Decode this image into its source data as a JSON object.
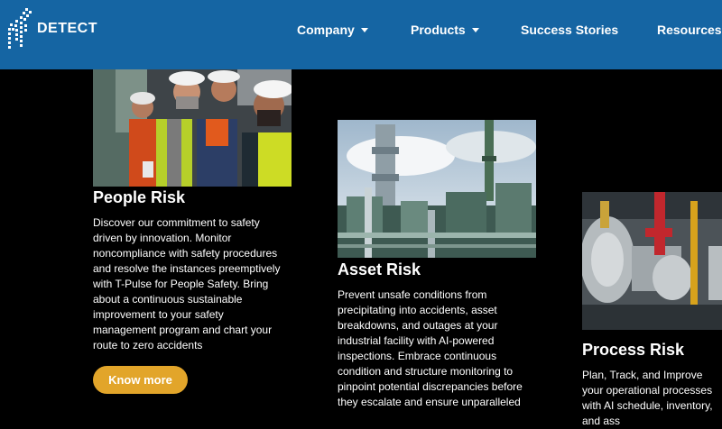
{
  "nav": {
    "logo_text": "DETECT",
    "items": [
      {
        "label": "Company"
      },
      {
        "label": "Products"
      },
      {
        "label": "Success Stories"
      },
      {
        "label": "Resources"
      }
    ]
  },
  "cards": [
    {
      "title": "People Risk",
      "description": "Discover our commitment to safety driven by innovation. Monitor noncompliance with safety procedures and resolve the instances preemptively with T-Pulse for People Safety. Bring about a continuous sustainable improvement to your safety management program and chart your route to zero accidents",
      "button_label": "Know more"
    },
    {
      "title": "Asset Risk",
      "description": "Prevent unsafe conditions from precipitating into accidents, asset breakdowns, and outages at your industrial facility with AI-powered inspections. Embrace continuous condition and structure monitoring to pinpoint potential discrepancies before they escalate and ensure unparalleled"
    },
    {
      "title": "Process Risk",
      "description": "Plan, Track, and Improve your operational processes with AI schedule, inventory, and ass"
    }
  ],
  "colors": {
    "navbar": "#1565a3",
    "button": "#e2a52a",
    "background": "#000000"
  }
}
